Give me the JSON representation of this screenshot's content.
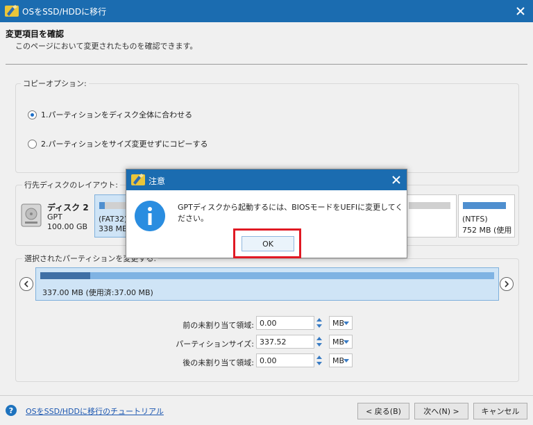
{
  "window": {
    "title": "OSをSSD/HDDに移行"
  },
  "header": {
    "title": "変更項目を確認",
    "subtitle": "このページにおいて変更されたものを確認できます。"
  },
  "copy_options": {
    "legend": "コピーオプション:",
    "option1": "1.パーティションをディスク全体に合わせる",
    "option2": "2.パーティションをサイズ変更せずにコピーする",
    "selected": 1
  },
  "layout": {
    "legend": "行先ディスクのレイアウト:",
    "disk_name": "ディスク 2",
    "disk_type": "GPT",
    "disk_size": "100.00 GB",
    "part1_name": "(FAT32)",
    "part1_size": "338 MB",
    "part2_name": "(NTFS)",
    "part2_size": "752 MB (使用"
  },
  "selected_partition": {
    "legend": "選択されたパーティションを変更する:",
    "label": "337.00 MB (使用済:37.00 MB)",
    "used_fraction": 0.11
  },
  "fields": {
    "before_label": "前の未割り当て領域:",
    "before_value": "0.00",
    "size_label": "パーティションサイズ:",
    "size_value": "337.52",
    "after_label": "後の未割り当て領域:",
    "after_value": "0.00",
    "unit": "MB"
  },
  "footer": {
    "help": "?",
    "tutorial": "OSをSSD/HDDに移行のチュートリアル",
    "back": "< 戻る(B)",
    "next": "次へ(N) >",
    "cancel": "キャンセル"
  },
  "dialog": {
    "title": "注意",
    "message": "GPTディスクから起動するには、BIOSモードをUEFIに変更してください。",
    "ok": "OK"
  },
  "colors": {
    "titlebar": "#1b6cb0",
    "highlight": "#e01923",
    "info": "#2a8de0"
  }
}
